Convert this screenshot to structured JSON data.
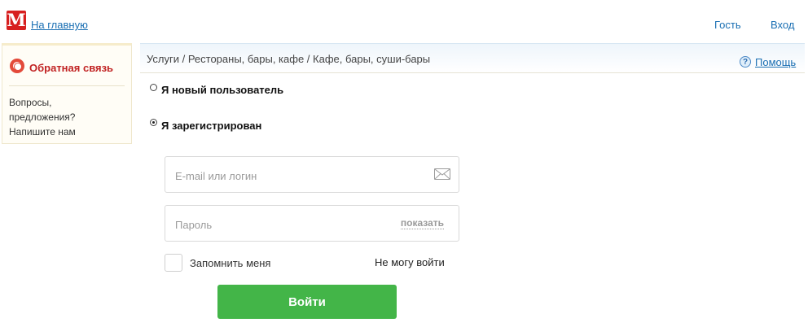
{
  "header": {
    "logo_letter": "M",
    "home_link": "На главную",
    "guest": "Гость",
    "login": "Вход"
  },
  "feedback": {
    "title": "Обратная связь",
    "lines": [
      "Вопросы,",
      "предложения?",
      "Напишите нам"
    ]
  },
  "breadcrumb": {
    "text": "Услуги / Рестораны, бары, кафе / Кафе, бары, суши-бары",
    "help_icon": "?",
    "help_label": "Помощь"
  },
  "auth": {
    "options": [
      {
        "label": "Я новый пользователь",
        "selected": false
      },
      {
        "label": "Я зарегистрирован",
        "selected": true
      }
    ],
    "login_field": {
      "value": "",
      "placeholder": "E-mail или логин",
      "icon": "envelope-icon"
    },
    "password_field": {
      "value": "",
      "placeholder": "Пароль",
      "toggle_label": "показать"
    },
    "remember_label": "Запомнить меня",
    "remember_checked": false,
    "cant_login_label": "Не могу войти",
    "submit_label": "Войти"
  },
  "colors": {
    "accent": "#43b548",
    "link": "#1a6fb3",
    "brand": "#d71f1f",
    "feedback_title": "#c12323"
  }
}
